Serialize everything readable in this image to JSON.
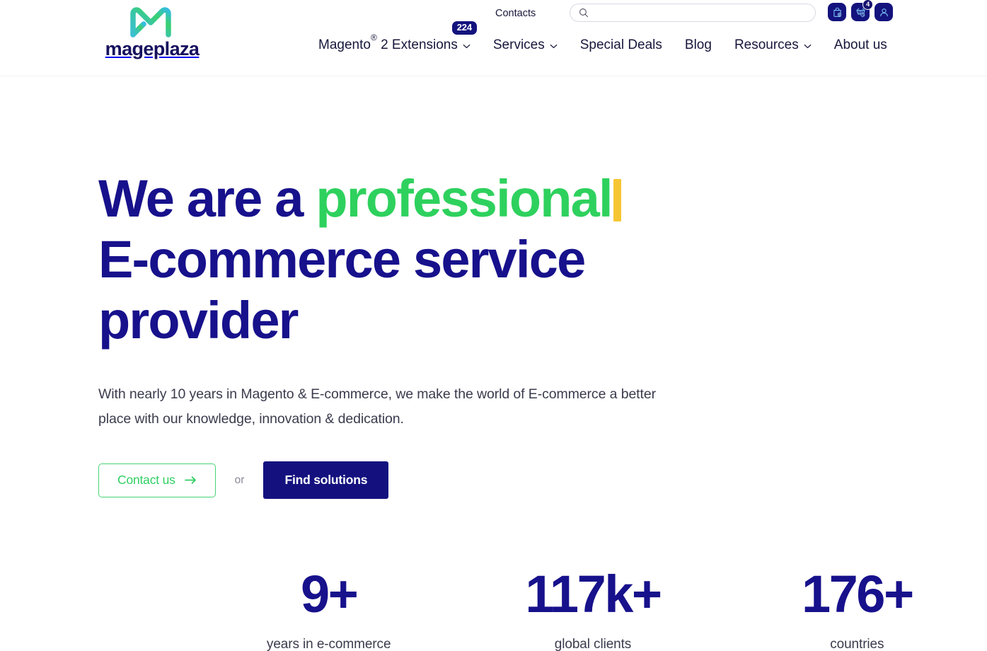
{
  "brand": {
    "name": "mageplaza",
    "logo_icon": "mageplaza-m-logo",
    "navy": "#17118c",
    "green": "#2ed15d",
    "accent_yellow": "#f6c632"
  },
  "header": {
    "contacts_label": "Contacts",
    "search": {
      "placeholder": "",
      "value": "",
      "icon": "search-icon"
    },
    "icon_buttons": [
      {
        "name": "bag-icon",
        "label": ""
      },
      {
        "name": "cart-icon",
        "label": "",
        "badge": "4"
      },
      {
        "name": "user-icon",
        "label": ""
      }
    ],
    "nav": [
      {
        "label": "Magento",
        "sup": "®",
        "label_after": " 2 Extensions",
        "has_chevron": true,
        "badge": "224"
      },
      {
        "label": "Services",
        "has_chevron": true
      },
      {
        "label": "Special Deals",
        "has_chevron": false
      },
      {
        "label": "Blog",
        "has_chevron": false
      },
      {
        "label": "Resources",
        "has_chevron": true
      },
      {
        "label": "About us",
        "has_chevron": false
      }
    ]
  },
  "hero": {
    "title_part1": "We are a ",
    "title_highlight": "professional",
    "title_part2": "E-commerce service provider",
    "subtitle": "With nearly 10 years in Magento & E-commerce, we make the world of E-commerce a better place with our knowledge, innovation & dedication.",
    "primary_cta": "Contact us",
    "separator": "or",
    "secondary_cta": "Find solutions"
  },
  "stats": [
    {
      "value": "9+",
      "label": "years in e-commerce"
    },
    {
      "value": "117k+",
      "label": "global clients"
    },
    {
      "value": "176+",
      "label": "countries"
    }
  ]
}
